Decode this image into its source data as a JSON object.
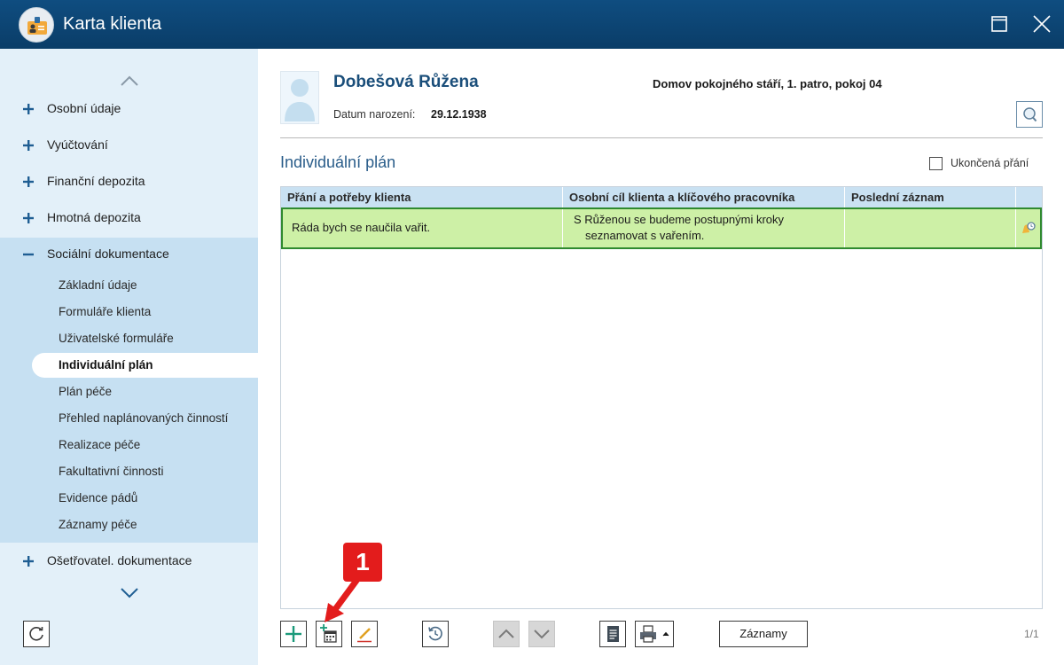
{
  "window": {
    "title": "Karta klienta"
  },
  "sidebar": {
    "sections": [
      {
        "label": "Osobní údaje"
      },
      {
        "label": "Vyúčtování"
      },
      {
        "label": "Finanční depozita"
      },
      {
        "label": "Hmotná depozita"
      },
      {
        "label": "Sociální dokumentace"
      },
      {
        "label": "Ošetřovatel. dokumentace"
      }
    ],
    "subitems": [
      {
        "label": "Základní údaje"
      },
      {
        "label": "Formuláře klienta"
      },
      {
        "label": "Uživatelské formuláře"
      },
      {
        "label": "Individuální plán"
      },
      {
        "label": "Plán péče"
      },
      {
        "label": "Přehled naplánovaných činností"
      },
      {
        "label": "Realizace péče"
      },
      {
        "label": "Fakultativní činnosti"
      },
      {
        "label": "Evidence pádů"
      },
      {
        "label": "Záznamy péče"
      }
    ],
    "active_subitem": "Individuální plán"
  },
  "client": {
    "name": "Dobešová Růžena",
    "location": "Domov pokojného stáří, 1. patro, pokoj 04",
    "dob_label": "Datum narození:",
    "dob": "29.12.1938"
  },
  "plan": {
    "title": "Individuální plán",
    "checkbox_label": "Ukončená přání",
    "checkbox_checked": false,
    "columns": [
      "Přání a potřeby klienta",
      "Osobní cíl klienta a klíčového pracovníka",
      "Poslední záznam"
    ],
    "rows": [
      {
        "wish": "Ráda bych se naučila vařit.",
        "goal_line1": "S Růženou se budeme postupnými kroky",
        "goal_line2": "seznamovat s vařením.",
        "last_record": ""
      }
    ]
  },
  "toolbar": {
    "records_label": "Záznamy",
    "page_info": "1/1"
  },
  "annotation": {
    "badge": "1",
    "color": "#e31c1c"
  },
  "colors": {
    "titlebar": "#0f4d80",
    "sidebar_bg": "#e3f0f9",
    "sidebar_expanded_bg": "#c6e0f2",
    "table_header": "#c9e1f2",
    "selected_row": "#cdf0a6",
    "selected_row_border": "#2f8a2f",
    "accent_text": "#1a4e7a"
  },
  "icons": {
    "app": "client-card-icon",
    "maximize": "maximize-icon",
    "close": "close-icon",
    "expand": "plus-icon",
    "collapse": "minus-icon",
    "search": "magnifier-icon",
    "add": "plus-icon",
    "add_schedule": "calendar-plus-icon",
    "edit": "pencil-icon",
    "history": "history-icon",
    "move_up": "chevron-up-icon",
    "move_down": "chevron-down-icon",
    "report": "document-icon",
    "print": "printer-icon",
    "refresh": "refresh-icon"
  }
}
